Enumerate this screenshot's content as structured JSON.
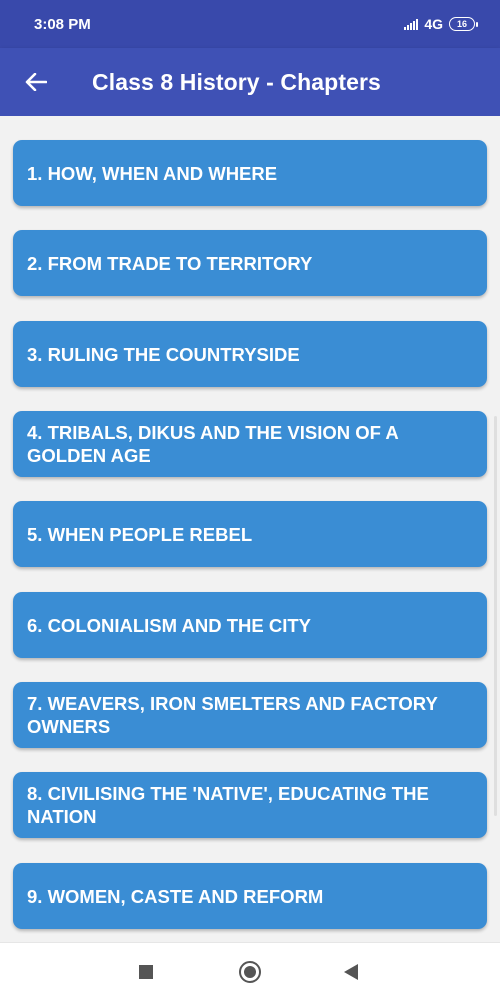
{
  "status_bar": {
    "time": "3:08 PM",
    "network": "4G",
    "battery": "16",
    "icons": [
      "signal-icon",
      "battery-icon"
    ]
  },
  "app_bar": {
    "title": "Class 8 History - Chapters",
    "back_icon": "arrow-left-icon"
  },
  "chapters": [
    "1. HOW, WHEN AND WHERE",
    "2. FROM TRADE TO TERRITORY",
    "3. RULING THE COUNTRYSIDE",
    "4. TRIBALS, DIKUS AND THE VISION OF A GOLDEN AGE",
    "5. WHEN PEOPLE REBEL",
    "6. COLONIALISM AND THE CITY",
    "7. WEAVERS, IRON SMELTERS AND FACTORY OWNERS",
    "8. CIVILISING THE 'NATIVE', EDUCATING THE NATION",
    "9. WOMEN, CASTE AND REFORM"
  ],
  "nav_bar": {
    "icons": [
      "recents-square-icon",
      "home-circle-icon",
      "back-triangle-icon"
    ]
  },
  "colors": {
    "status_bar": "#3949ab",
    "app_bar": "#3f51b5",
    "chapter_button": "#3a8dd4",
    "list_background": "#f2f2f2"
  }
}
